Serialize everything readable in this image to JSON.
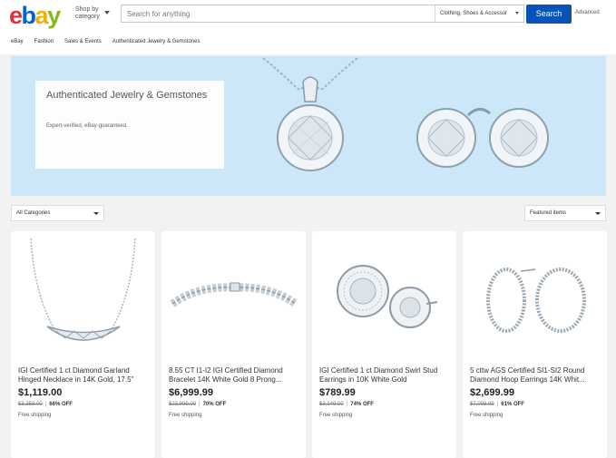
{
  "header": {
    "logo": {
      "l1": "e",
      "l2": "b",
      "l3": "a",
      "l4": "y"
    },
    "shop_by_line1": "Shop by",
    "shop_by_line2": "category",
    "search_placeholder": "Search for anything",
    "category_select": "Clothing, Shoes & Accessor",
    "search_button": "Search",
    "advanced": "Advanced"
  },
  "breadcrumb": [
    "eBay",
    "Fashion",
    "Sales & Events",
    "Authenticated Jewelry & Gemstones"
  ],
  "banner": {
    "title": "Authenticated Jewelry & Gemstones",
    "subtitle": "Expert-verified, eBay-guaranteed."
  },
  "filters": {
    "category": "All Categories",
    "sort": "Featured items"
  },
  "products": [
    {
      "title": "IGI Certified 1 ct Diamond Garland Hinged Necklace in 14K Gold, 17.5\"",
      "price": "$1,119.00",
      "was": "$3,358.00",
      "off": "66% OFF",
      "shipping": "Free shipping"
    },
    {
      "title": "8.55 CT I1-I2 IGI Certified Diamond Bracelet 14K White Gold 8 Prong...",
      "price": "$6,999.99",
      "was": "$23,999.00",
      "off": "70% OFF",
      "shipping": "Free shipping"
    },
    {
      "title": "IGI Certified 1 ct Diamond Swirl Stud Earrings in 10K White Gold",
      "price": "$789.99",
      "was": "$3,149.00",
      "off": "74% OFF",
      "shipping": "Free shipping"
    },
    {
      "title": "5 cttw AGS Certified SI1-SI2 Round Diamond Hoop Earrings 14K Whit...",
      "price": "$2,699.99",
      "was": "$7,098.99",
      "off": "61% OFF",
      "shipping": "Free shipping"
    }
  ],
  "colors": {
    "brand_blue": "#0654ba",
    "banner_bg": "#cce8f8",
    "page_bg": "#f2f2f2"
  }
}
